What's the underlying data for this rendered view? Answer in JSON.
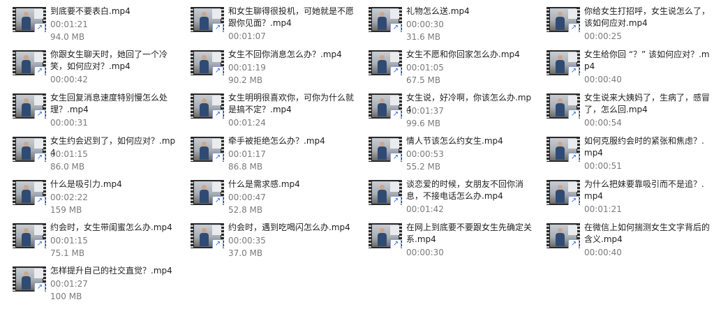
{
  "files": [
    {
      "name": "到底要不要表白.mp4",
      "duration": "00:01:21",
      "size": "94.0 MB"
    },
    {
      "name": "和女生聊得很投机，可她就是不愿跟你见面？.mp4",
      "duration": "00:01:07",
      "size": ""
    },
    {
      "name": "礼物怎么送.mp4",
      "duration": "00:00:30",
      "size": "31.6 MB"
    },
    {
      "name": "你给女生打招呼，女生说怎么了，该如何应对.mp4",
      "duration": "00:00:25",
      "size": ""
    },
    {
      "name": "你跟女生聊天时，她回了一个冷笑，如何应对？.mp4",
      "duration": "00:00:42",
      "size": ""
    },
    {
      "name": "女生不回你消息怎么办？.mp4",
      "duration": "00:01:19",
      "size": "90.2 MB"
    },
    {
      "name": "女生不愿和你回家怎么办.mp4",
      "duration": "00:01:05",
      "size": "67.5 MB"
    },
    {
      "name": "女生给你回 “？” 该如何应对？.mp4",
      "duration": "00:00:40",
      "size": ""
    },
    {
      "name": "女生回复消息速度特别慢怎么处理？.mp4",
      "duration": "00:00:31",
      "size": ""
    },
    {
      "name": "女生明明很喜欢你，可你为什么就是搞不定？.mp4",
      "duration": "00:01:24",
      "size": ""
    },
    {
      "name": "女生说，好冷啊，你该怎么办.mp4",
      "duration": "00:01:37",
      "size": "99.6 MB"
    },
    {
      "name": "女生说来大姨妈了，生病了，感冒了，怎么回.mp4",
      "duration": "00:00:54",
      "size": ""
    },
    {
      "name": "女生约会迟到了，如何应对？.mp4",
      "duration": "00:01:15",
      "size": "86.0 MB"
    },
    {
      "name": "牵手被拒绝怎么办？.mp4",
      "duration": "00:01:17",
      "size": "86.8 MB"
    },
    {
      "name": "情人节该怎么约女生.mp4",
      "duration": "00:00:53",
      "size": "55.2 MB"
    },
    {
      "name": "如何克服约会时的紧张和焦虑？.mp4",
      "duration": "00:00:51",
      "size": ""
    },
    {
      "name": "什么是吸引力.mp4",
      "duration": "00:02:22",
      "size": "159 MB"
    },
    {
      "name": "什么是需求感.mp4",
      "duration": "00:00:47",
      "size": "52.8 MB"
    },
    {
      "name": "谈恋爱的时候，女朋友不回你消息，不接电话怎么办.mp4",
      "duration": "00:01:42",
      "size": ""
    },
    {
      "name": "为什么把妹要靠吸引而不是追？.mp4",
      "duration": "00:01:21",
      "size": ""
    },
    {
      "name": "约会时，女生带闺蜜怎么办.mp4",
      "duration": "00:01:15",
      "size": "75.1 MB"
    },
    {
      "name": "约会时，遇到吃喝闪怎么办.mp4",
      "duration": "00:00:35",
      "size": "37.0 MB"
    },
    {
      "name": "在网上到底要不要跟女生先确定关系.mp4",
      "duration": "00:00:30",
      "size": ""
    },
    {
      "name": "在微信上如何揣测女生文字背后的含义.mp4",
      "duration": "00:00:40",
      "size": ""
    },
    {
      "name": "怎样提升自己的社交直觉？.mp4",
      "duration": "00:01:27",
      "size": "100 MB"
    }
  ],
  "icons": {
    "thumbnail": "video-thumbnail-icon",
    "shortcut": "shortcut-arrow-icon"
  },
  "colors": {
    "meta_text": "#7a7a7a",
    "shortcut_arrow": "#2d6bd2"
  }
}
